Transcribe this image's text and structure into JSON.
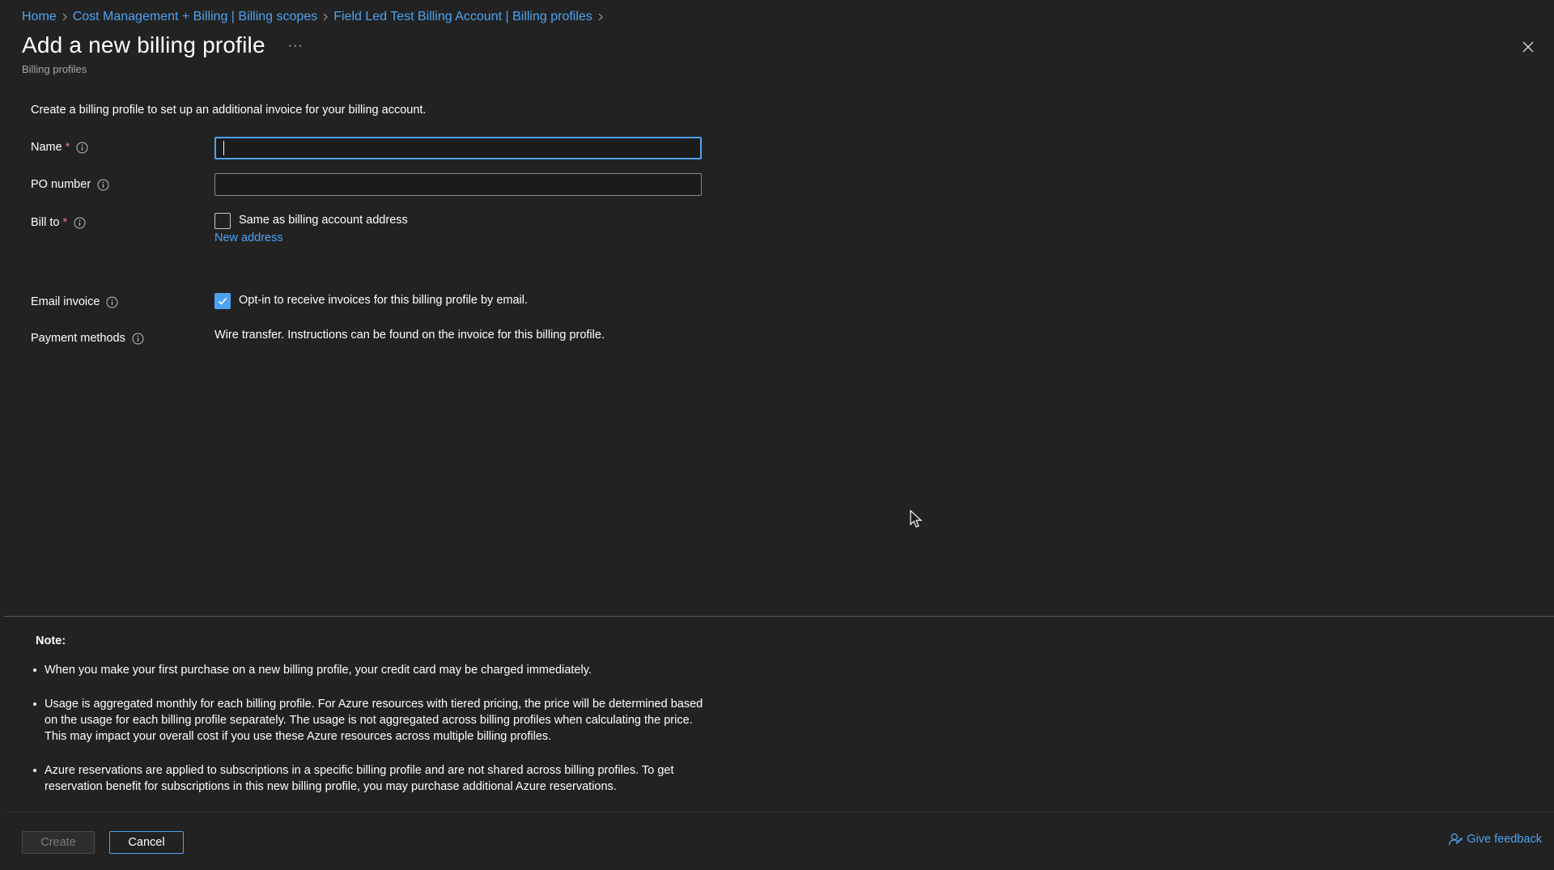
{
  "breadcrumb": {
    "items": [
      {
        "label": "Home"
      },
      {
        "label": "Cost Management + Billing | Billing scopes"
      },
      {
        "label": "Field Led Test Billing Account | Billing profiles"
      }
    ]
  },
  "header": {
    "title": "Add a new billing profile",
    "more_label": "···",
    "subtitle": "Billing profiles"
  },
  "form": {
    "description": "Create a billing profile to set up an additional invoice for your billing account.",
    "name": {
      "label": "Name",
      "required_mark": "*",
      "value": ""
    },
    "po_number": {
      "label": "PO number",
      "value": ""
    },
    "bill_to": {
      "label": "Bill to",
      "required_mark": "*",
      "same_as_label": "Same as billing account address",
      "same_as_checked": false,
      "new_address_label": "New address"
    },
    "email_invoice": {
      "label": "Email invoice",
      "opt_in_label": "Opt-in to receive invoices for this billing profile by email.",
      "opt_in_checked": true
    },
    "payment_methods": {
      "label": "Payment methods",
      "value": "Wire transfer. Instructions can be found on the invoice for this billing profile."
    }
  },
  "note": {
    "title": "Note:",
    "items": [
      "When you make your first purchase on a new billing profile, your credit card may be charged immediately.",
      "Usage is aggregated monthly for each billing profile. For Azure resources with tiered pricing, the price will be determined based on the usage for each billing profile separately. The usage is not aggregated across billing profiles when calculating the price. This may impact your overall cost if you use these Azure resources across multiple billing profiles.",
      "Azure reservations are applied to subscriptions in a specific billing profile and are not shared across billing profiles. To get reservation benefit for subscriptions in this new billing profile, you may purchase additional Azure reservations."
    ]
  },
  "footer": {
    "create_label": "Create",
    "cancel_label": "Cancel",
    "feedback_label": "Give feedback"
  },
  "colors": {
    "background": "#222222",
    "accent": "#4ea3f1",
    "required": "#f1707b",
    "text": "#ffffff",
    "muted": "#a6a6a6"
  },
  "icons": {
    "breadcrumb_separator": "chevron-right-icon",
    "close": "close-icon",
    "info": "info-icon",
    "checkmark": "checkmark-icon",
    "feedback": "feedback-person-icon",
    "cursor": "mouse-pointer-icon"
  }
}
